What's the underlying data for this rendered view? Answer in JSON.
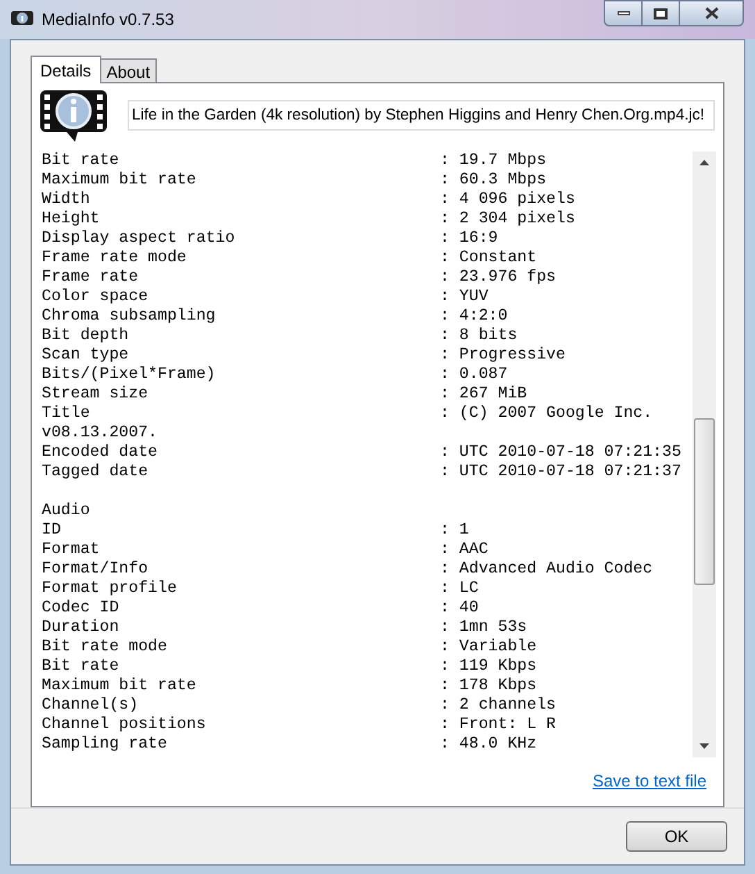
{
  "window": {
    "title": "MediaInfo v0.7.53"
  },
  "tabs": [
    {
      "label": "Details",
      "selected": true
    },
    {
      "label": "About",
      "selected": false
    }
  ],
  "file_name": "Life in the Garden (4k resolution) by Stephen Higgins and Henry Chen.Org.mp4.jc!",
  "lines": [
    {
      "kind": "field",
      "key": "Bit rate",
      "value": ": 19.7 Mbps"
    },
    {
      "kind": "field",
      "key": "Maximum bit rate",
      "value": ": 60.3 Mbps"
    },
    {
      "kind": "field",
      "key": "Width",
      "value": ": 4 096 pixels"
    },
    {
      "kind": "field",
      "key": "Height",
      "value": ": 2 304 pixels"
    },
    {
      "kind": "field",
      "key": "Display aspect ratio",
      "value": ": 16:9"
    },
    {
      "kind": "field",
      "key": "Frame rate mode",
      "value": ": Constant"
    },
    {
      "kind": "field",
      "key": "Frame rate",
      "value": ": 23.976 fps"
    },
    {
      "kind": "field",
      "key": "Color space",
      "value": ": YUV"
    },
    {
      "kind": "field",
      "key": "Chroma subsampling",
      "value": ": 4:2:0"
    },
    {
      "kind": "field",
      "key": "Bit depth",
      "value": ": 8 bits"
    },
    {
      "kind": "field",
      "key": "Scan type",
      "value": ": Progressive"
    },
    {
      "kind": "field",
      "key": "Bits/(Pixel*Frame)",
      "value": ": 0.087"
    },
    {
      "kind": "field",
      "key": "Stream size",
      "value": ": 267 MiB"
    },
    {
      "kind": "field",
      "key": "Title",
      "value": ": (C) 2007 Google Inc."
    },
    {
      "kind": "text",
      "text": "v08.13.2007."
    },
    {
      "kind": "field",
      "key": "Encoded date",
      "value": ": UTC 2010-07-18 07:21:35"
    },
    {
      "kind": "field",
      "key": "Tagged date",
      "value": ": UTC 2010-07-18 07:21:37"
    },
    {
      "kind": "blank"
    },
    {
      "kind": "text",
      "text": "Audio"
    },
    {
      "kind": "field",
      "key": "ID",
      "value": ": 1"
    },
    {
      "kind": "field",
      "key": "Format",
      "value": ": AAC"
    },
    {
      "kind": "field",
      "key": "Format/Info",
      "value": ": Advanced Audio Codec"
    },
    {
      "kind": "field",
      "key": "Format profile",
      "value": ": LC"
    },
    {
      "kind": "field",
      "key": "Codec ID",
      "value": ": 40"
    },
    {
      "kind": "field",
      "key": "Duration",
      "value": ": 1mn 53s"
    },
    {
      "kind": "field",
      "key": "Bit rate mode",
      "value": ": Variable"
    },
    {
      "kind": "field",
      "key": "Bit rate",
      "value": ": 119 Kbps"
    },
    {
      "kind": "field",
      "key": "Maximum bit rate",
      "value": ": 178 Kbps"
    },
    {
      "kind": "field",
      "key": "Channel(s)",
      "value": ": 2 channels"
    },
    {
      "kind": "field",
      "key": "Channel positions",
      "value": ": Front: L R"
    },
    {
      "kind": "field",
      "key": "Sampling rate",
      "value": ": 48.0 KHz"
    }
  ],
  "save_link": "Save to text file",
  "buttons": [
    "OK"
  ]
}
